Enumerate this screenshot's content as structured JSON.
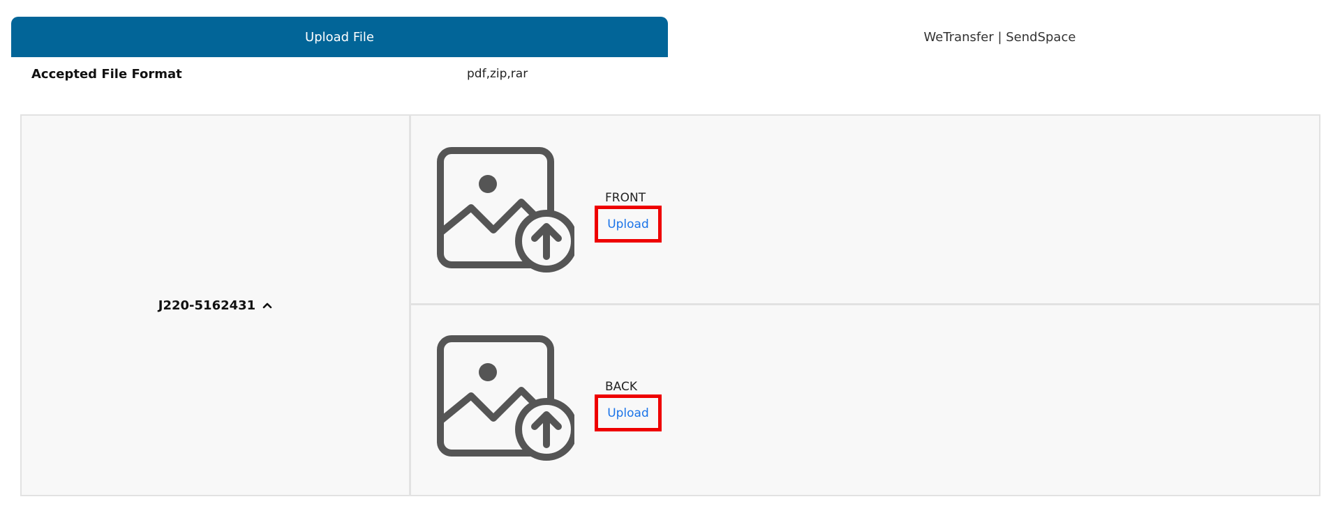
{
  "tabs": [
    {
      "label": "Upload File",
      "active": true
    },
    {
      "label": "WeTransfer | SendSpace",
      "active": false
    }
  ],
  "format": {
    "label": "Accepted File Format",
    "value": "pdf,zip,rar"
  },
  "job": {
    "id": "J220-5162431",
    "expanded_icon": "chevron-up-icon"
  },
  "uploads": [
    {
      "side": "FRONT",
      "action": "Upload",
      "icon": "image-upload-icon"
    },
    {
      "side": "BACK",
      "action": "Upload",
      "icon": "image-upload-icon"
    }
  ],
  "colors": {
    "tab_active": "#026598",
    "link": "#1a73e8",
    "highlight": "#ee0000",
    "icon": "#555555"
  }
}
